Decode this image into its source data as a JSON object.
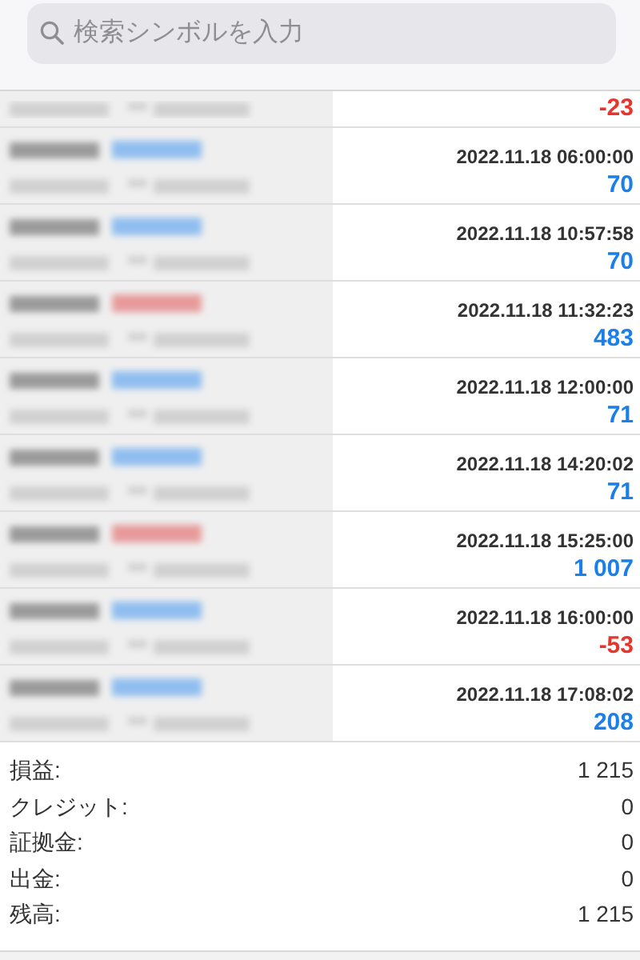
{
  "search": {
    "placeholder": "検索シンボルを入力"
  },
  "rows": [
    {
      "profit": {
        "text": "-23",
        "color": "#e8352b"
      }
    },
    {
      "time": "2022.11.18 06:00:00",
      "profit": {
        "text": "70",
        "color": "#1a7fe8"
      },
      "tag": {
        "color": "#8fbdf0"
      }
    },
    {
      "time": "2022.11.18 10:57:58",
      "profit": {
        "text": "70",
        "color": "#1a7fe8"
      },
      "tag": {
        "color": "#8fbdf0"
      }
    },
    {
      "time": "2022.11.18 11:32:23",
      "profit": {
        "text": "483",
        "color": "#1a7fe8"
      },
      "tag": {
        "color": "#e89a9a"
      }
    },
    {
      "time": "2022.11.18 12:00:00",
      "profit": {
        "text": "71",
        "color": "#1a7fe8"
      },
      "tag": {
        "color": "#8fbdf0"
      }
    },
    {
      "time": "2022.11.18 14:20:02",
      "profit": {
        "text": "71",
        "color": "#1a7fe8"
      },
      "tag": {
        "color": "#8fbdf0"
      }
    },
    {
      "time": "2022.11.18 15:25:00",
      "profit": {
        "text": "1 007",
        "color": "#1a7fe8"
      },
      "tag": {
        "color": "#e89a9a"
      }
    },
    {
      "time": "2022.11.18 16:00:00",
      "profit": {
        "text": "-53",
        "color": "#e8352b"
      },
      "tag": {
        "color": "#8fbdf0"
      }
    },
    {
      "time": "2022.11.18 17:08:02",
      "profit": {
        "text": "208",
        "color": "#1a7fe8"
      },
      "tag": {
        "color": "#8fbdf0"
      }
    }
  ],
  "summary": [
    {
      "label": "損益:",
      "value": "1 215"
    },
    {
      "label": "クレジット:",
      "value": "0"
    },
    {
      "label": "証拠金:",
      "value": "0"
    },
    {
      "label": "出金:",
      "value": "0"
    },
    {
      "label": "残高:",
      "value": "1 215"
    }
  ]
}
